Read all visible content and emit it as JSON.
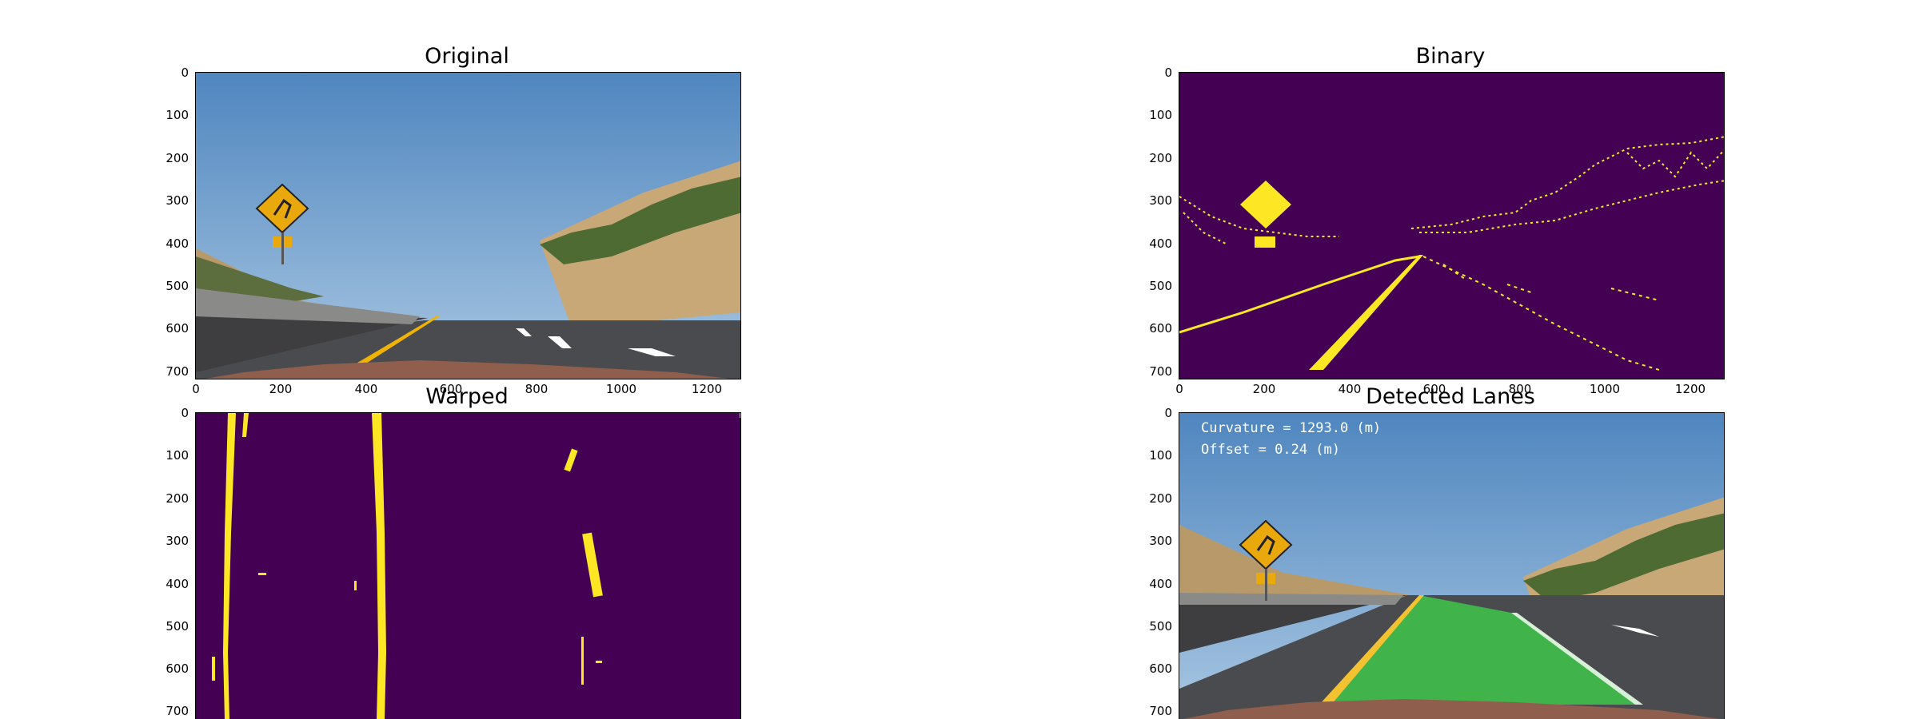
{
  "panels": {
    "original": {
      "title": "Original"
    },
    "binary": {
      "title": "Binary"
    },
    "warped": {
      "title": "Warped"
    },
    "detected": {
      "title": "Detected Lanes"
    }
  },
  "axes": {
    "yticks": [
      "0",
      "100",
      "200",
      "300",
      "400",
      "500",
      "600",
      "700"
    ],
    "xticks": [
      "0",
      "200",
      "400",
      "600",
      "800",
      "1000",
      "1200"
    ]
  },
  "overlay": {
    "curvature": "Curvature = 1293.0 (m)",
    "offset": "Offset = 0.24 (m)"
  },
  "colors": {
    "viridis_dark": "#440154",
    "viridis_yellow": "#fde725",
    "lane_fill": "#3fbf4a",
    "lane_left": "#f2c230"
  }
}
